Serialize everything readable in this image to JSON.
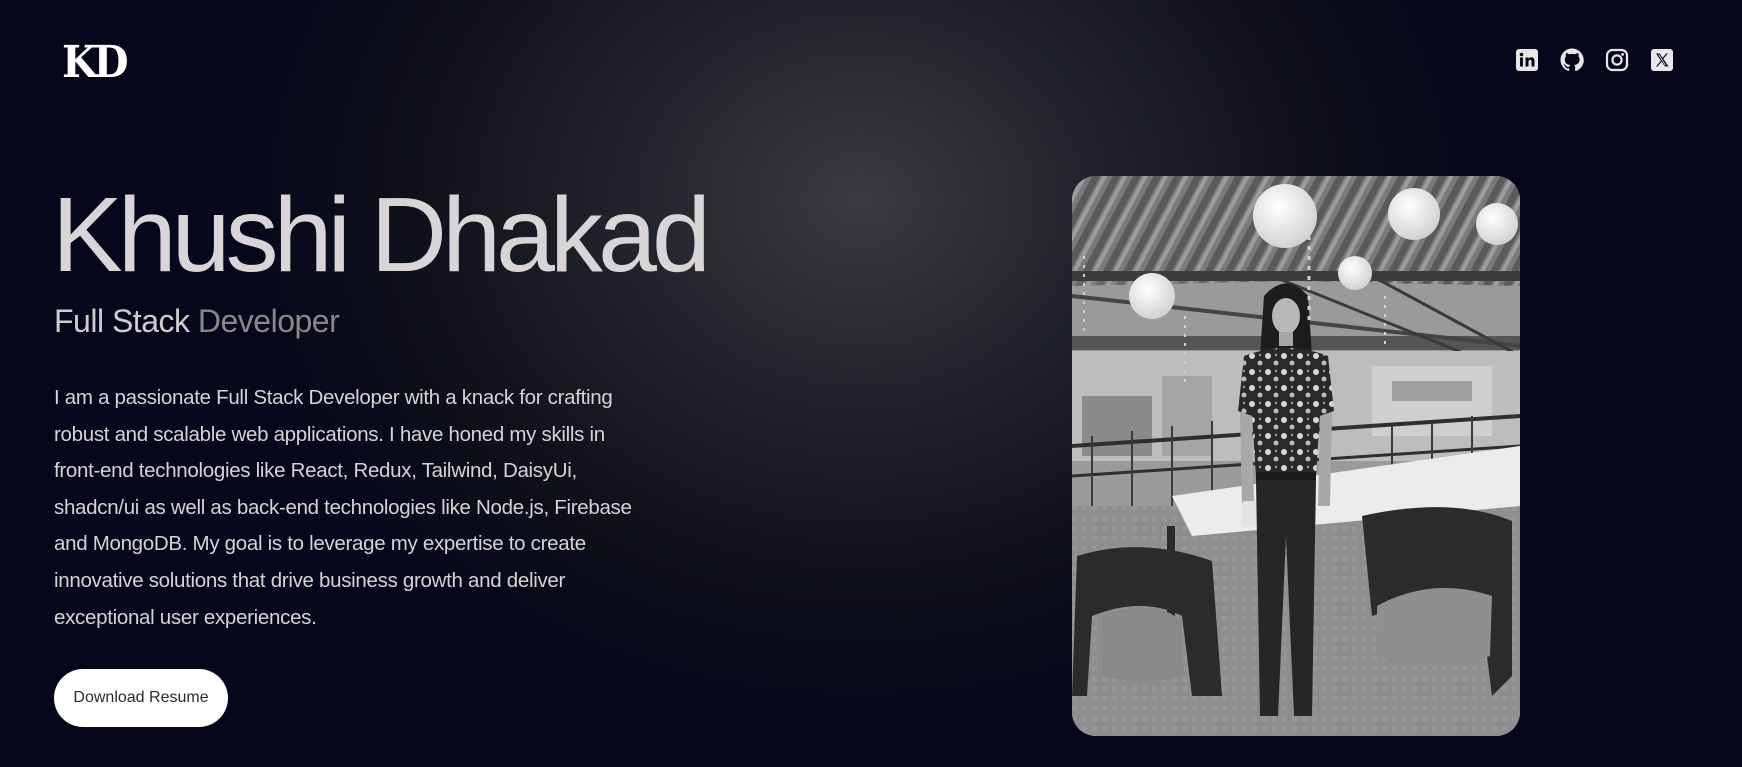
{
  "header": {
    "logo_text": "KD",
    "social_links": [
      {
        "name": "LinkedIn",
        "icon": "linkedin-icon"
      },
      {
        "name": "GitHub",
        "icon": "github-icon"
      },
      {
        "name": "Instagram",
        "icon": "instagram-icon"
      },
      {
        "name": "X",
        "icon": "x-icon"
      }
    ]
  },
  "hero": {
    "name": "Khushi Dhakad",
    "subtitle_part1": "Full Stack",
    "subtitle_part2": "Developer",
    "bio": "I am a passionate Full Stack Developer with a knack for crafting robust and scalable web applications. I have honed my skills in front-end technologies like React, Redux, Tailwind, DaisyUi, shadcn/ui as well as back-end technologies like Node.js, Firebase and MongoDB. My goal is to leverage my expertise to create innovative solutions that drive business growth and deliver exceptional user experiences.",
    "resume_button_label": "Download Resume"
  },
  "colors": {
    "background": "#06071a",
    "text": "#d6d3d4",
    "subtitle_muted": "#8a8789",
    "button_bg": "#ffffff"
  }
}
